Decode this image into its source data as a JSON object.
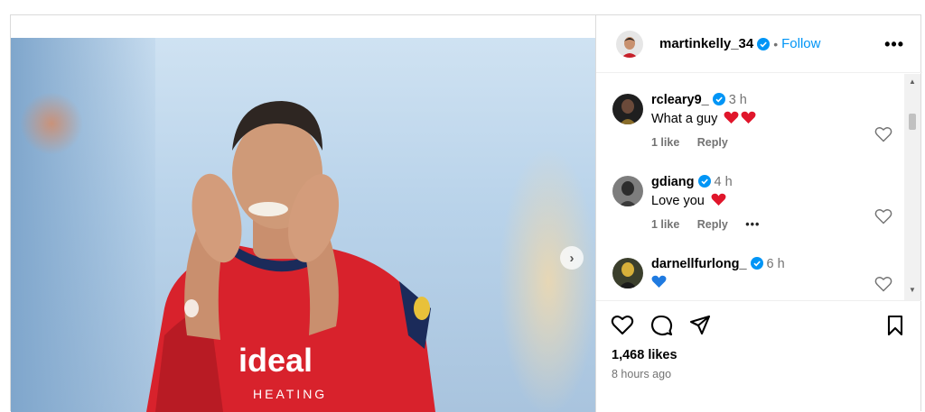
{
  "post": {
    "author": "martinkelly_34",
    "verified": true,
    "separator": "•",
    "follow_label": "Follow",
    "more_label": "•••",
    "media": {
      "shirt_sponsor": "ideal",
      "shirt_sponsor_sub": "HEATING",
      "next_icon": "chevron-right-icon"
    }
  },
  "comments": [
    {
      "user": "rcleary9_",
      "verified": true,
      "time": "3 h",
      "text": "What a guy",
      "emoji": [
        "red-heart",
        "red-heart"
      ],
      "likes": "1 like",
      "reply": "Reply"
    },
    {
      "user": "gdiang",
      "verified": true,
      "time": "4 h",
      "text": "Love you",
      "emoji": [
        "red-heart"
      ],
      "likes": "1 like",
      "reply": "Reply",
      "more": "•••"
    },
    {
      "user": "darnellfurlong_",
      "verified": true,
      "time": "6 h",
      "text": "",
      "emoji": [
        "blue-heart"
      ]
    }
  ],
  "footer": {
    "likes": "1,468 likes",
    "time_ago": "8 hours ago"
  },
  "colors": {
    "accent": "#0095f6",
    "verified": "#0095f6",
    "muted": "#737373",
    "red_heart": "#e0162b",
    "blue_heart": "#1f7ae0"
  }
}
